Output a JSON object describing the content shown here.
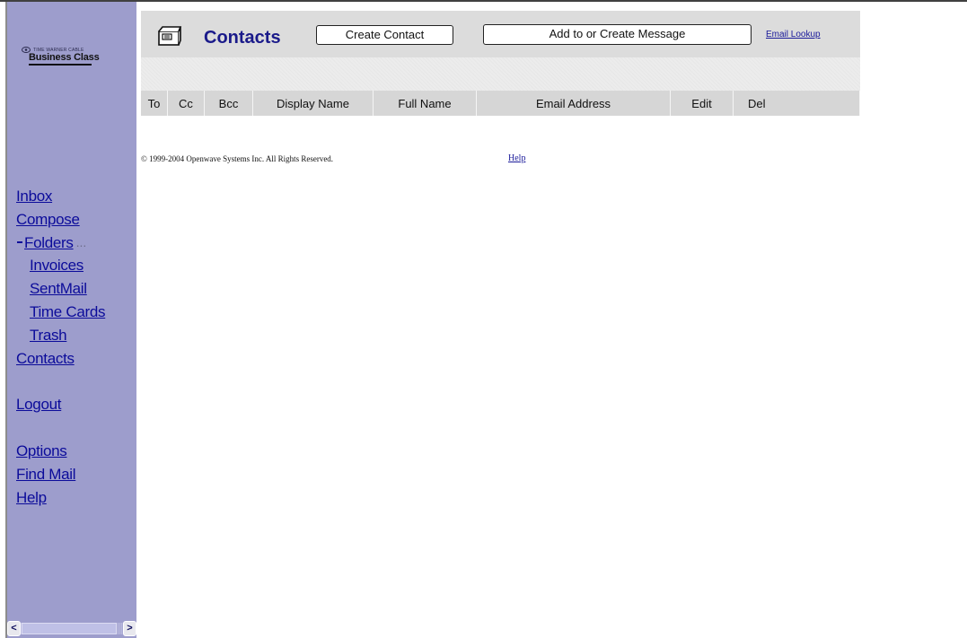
{
  "logo": {
    "small_text": "TIME WARNER CABLE",
    "big_text": "Business Class"
  },
  "nav": {
    "inbox": "Inbox",
    "compose": "Compose",
    "folders": "Folders",
    "folders_more": "...",
    "folder_items": [
      "Invoices",
      "SentMail",
      "Time Cards",
      "Trash"
    ],
    "contacts": "Contacts",
    "logout": "Logout",
    "options": "Options",
    "find_mail": "Find Mail",
    "help": "Help"
  },
  "scroll": {
    "left_arrow": "<",
    "right_arrow": ">"
  },
  "header": {
    "title": "Contacts",
    "create_contact_label": "Create Contact",
    "add_message_label": "Add to or Create Message",
    "email_lookup_label": "Email Lookup"
  },
  "table": {
    "columns": [
      "To",
      "Cc",
      "Bcc",
      "Display Name",
      "Full Name",
      "Email Address",
      "Edit",
      "Del"
    ]
  },
  "footer": {
    "copyright": "© 1999-2004 Openwave Systems Inc. All Rights Reserved.",
    "help_label": "Help"
  },
  "colors": {
    "sidebar": "#9d9dcc",
    "link": "#0b0b9a",
    "title": "#1a1a8a",
    "header_gray": "#dcdcdc"
  }
}
